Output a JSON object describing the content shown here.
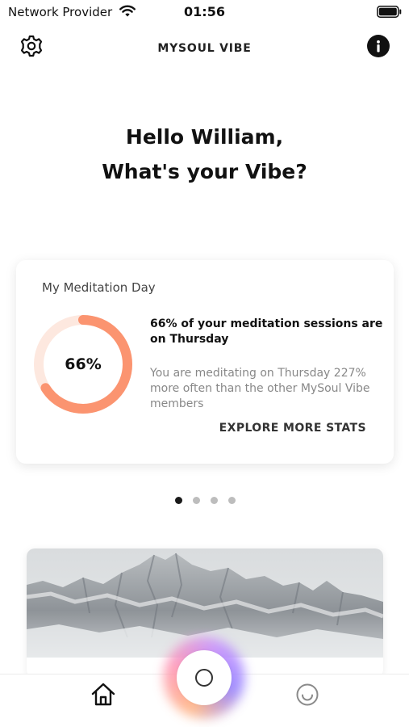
{
  "status_bar": {
    "carrier": "Network Provider",
    "time": "01:56"
  },
  "header": {
    "title": "MYSOUL VIBE",
    "settings_icon": "gear-icon",
    "info_icon": "info-icon"
  },
  "greeting": {
    "line1": "Hello William,",
    "line2": "What's your Vibe?"
  },
  "stats_card": {
    "title": "My Meditation Day",
    "percent_label": "66%",
    "percent_value": 66,
    "ring_color": "#fb9470",
    "ring_track_color": "#fde8df",
    "headline": "66% of your meditation sessions are on Thursday",
    "detail": "You are meditating on Thursday 227% more often than the other MySoul Vibe members",
    "link": "EXPLORE MORE STATS"
  },
  "pager": {
    "count": 4,
    "active_index": 0
  },
  "image_card": {
    "image": "snowy-mountain-photo"
  },
  "tab_bar": {
    "items": [
      {
        "icon": "home-icon"
      },
      {
        "icon": "record-circle-icon"
      },
      {
        "icon": "smile-face-icon"
      }
    ]
  }
}
